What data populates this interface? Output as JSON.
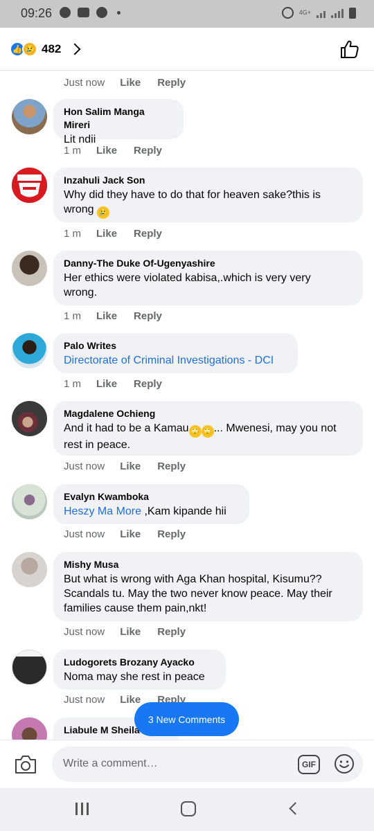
{
  "status_bar": {
    "time": "09:26",
    "network": "4G+"
  },
  "header": {
    "reaction_count": "482",
    "like_emoji": "👍",
    "sad_emoji": "😢"
  },
  "first_actions": {
    "time": "Just now",
    "like": "Like",
    "reply": "Reply"
  },
  "comments": [
    {
      "name": "Hon Salim Manga Mireri",
      "text": "Lit ndii",
      "time": "1 m",
      "like": "Like",
      "reply": "Reply"
    },
    {
      "name": "Inzahuli Jack Son",
      "text_line1": "Why did they have to do that for heaven sake?this is",
      "text_line2": "wrong",
      "emoji": "😢",
      "time": "1 m",
      "like": "Like",
      "reply": "Reply"
    },
    {
      "name": "Danny-The Duke Of-Ugenyashire",
      "text_line1": "Her ethics were violated kabisa,.which is very very",
      "text_line2": "wrong.",
      "time": "1 m",
      "like": "Like",
      "reply": "Reply"
    },
    {
      "name": "Palo Writes",
      "link": "Directorate of Criminal Investigations - DCI",
      "time": "1 m",
      "like": "Like",
      "reply": "Reply"
    },
    {
      "name": "Magdalene Ochieng",
      "text_line1_a": "And it had to be a Kamau",
      "emoji": "🙄",
      "text_line1_b": "... Mwenesi, may you not",
      "text_line2": "rest in peace.",
      "time": "Just now",
      "like": "Like",
      "reply": "Reply"
    },
    {
      "name": "Evalyn Kwamboka",
      "link": "Heszy Ma More",
      "text": " ,Kam kipande hii",
      "time": "Just now",
      "like": "Like",
      "reply": "Reply"
    },
    {
      "name": "Mishy Musa",
      "text_line1": "But what is wrong with Aga Khan hospital, Kisumu??",
      "text_line2": "Scandals tu. May the two never know peace. May their",
      "text_line3": "families cause them pain,nkt!",
      "time": "Just now",
      "like": "Like",
      "reply": "Reply"
    },
    {
      "name": "Ludogorets Brozany Ayacko",
      "text": "Noma may she rest in peace",
      "time": "Just now",
      "like": "Like",
      "reply": "Reply"
    },
    {
      "name": "Liabule M Sheila"
    }
  ],
  "new_comments_button": "3 New Comments",
  "composer": {
    "placeholder": "Write a comment…",
    "gif_label": "GIF"
  },
  "colors": {
    "accent": "#1877f2",
    "link": "#216fdb",
    "bubble": "#f0f2f5"
  }
}
